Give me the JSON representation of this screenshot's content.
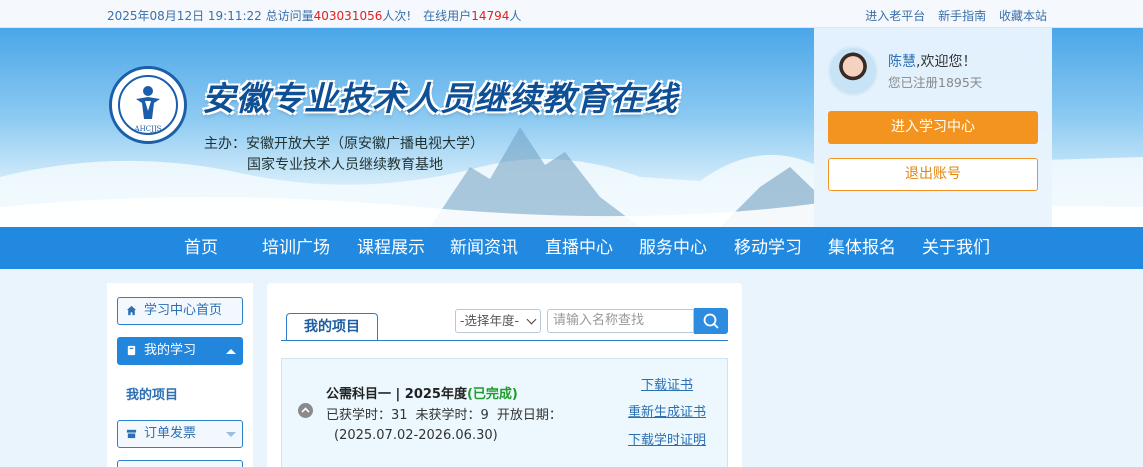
{
  "topbar": {
    "datetime": "2025年08月12日 19:11:22",
    "visits_prefix": "总访问量",
    "visits_count": "403031056",
    "visits_suffix": "人次!",
    "online_prefix": "在线用户",
    "online_count": "14794",
    "online_suffix": "人",
    "links": [
      "进入老平台",
      "新手指南",
      "收藏本站"
    ]
  },
  "banner": {
    "logo_text": "AHCJJS",
    "site_title": "安徽专业技术人员继续教育在线",
    "sponsor_line1": "主办：安徽开放大学（原安徽广播电视大学）",
    "sponsor_line2": "国家专业技术人员继续教育基地"
  },
  "user": {
    "name": "陈慧",
    "greeting": ",欢迎您！",
    "registered": "您已注册1895天",
    "enter_button": "进入学习中心",
    "logout_button": "退出账号"
  },
  "nav": {
    "items": [
      "首页",
      "培训广场",
      "课程展示",
      "新闻资讯",
      "直播中心",
      "服务中心",
      "移动学习",
      "集体报名",
      "关于我们"
    ]
  },
  "sidebar": {
    "home": "学习中心首页",
    "my_study": "我的学习",
    "my_projects": "我的项目",
    "orders": "订单发票"
  },
  "main": {
    "tab_label": "我的项目",
    "year_select": "-选择年度-",
    "search_placeholder": "请输入名称查找",
    "project": {
      "title": "公需科目一 | 2025年度",
      "status": "(已完成)",
      "earned": "已获学时：31",
      "unearned": "未获学时：9",
      "open_date_label": "开放日期：",
      "open_date": "(2025.07.02-2026.06.30)",
      "links": [
        "下载证书",
        "重新生成证书",
        "下载学时证明"
      ]
    }
  },
  "colors": {
    "nav_blue": "#2289e0",
    "orange": "#f2941f",
    "link_blue": "#2c6fb2",
    "done_green": "#1e9a2e",
    "stat_red": "#e02020"
  }
}
